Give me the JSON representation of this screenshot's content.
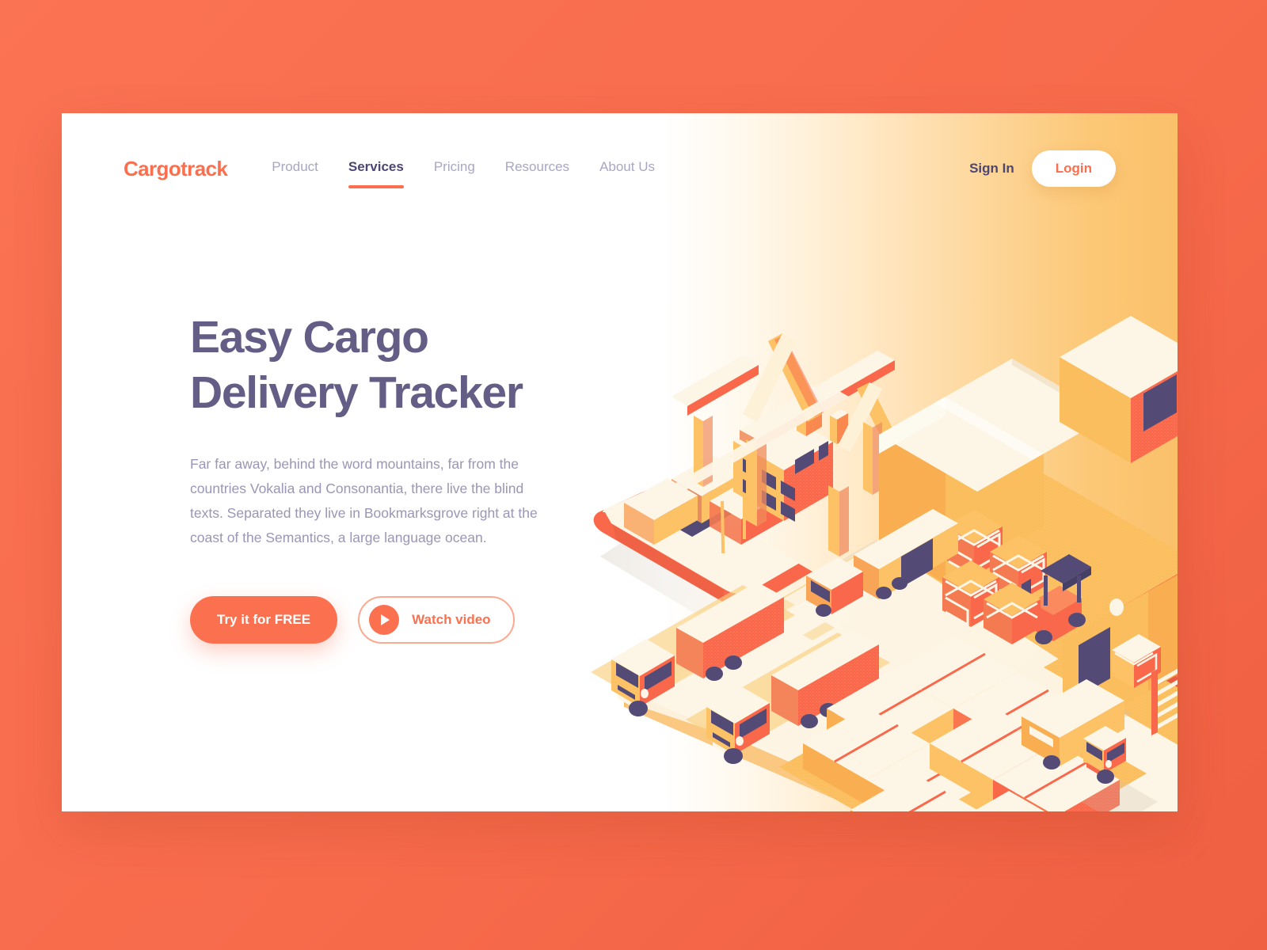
{
  "brand": {
    "name": "Cargotrack"
  },
  "nav": {
    "items": [
      {
        "label": "Product",
        "active": false
      },
      {
        "label": "Services",
        "active": true
      },
      {
        "label": "Pricing",
        "active": false
      },
      {
        "label": "Resources",
        "active": false
      },
      {
        "label": "About Us",
        "active": false
      }
    ],
    "sign_in_label": "Sign In",
    "login_label": "Login"
  },
  "hero": {
    "title_line1": "Easy Cargo",
    "title_line2": "Delivery Tracker",
    "subtitle": "Far far away, behind the word mountains, far from the countries Vokalia and Consonantia, there live the blind texts. Separated they live in Bookmarksgrove right at the coast of the Semantics, a large language ocean.",
    "primary_cta": "Try it for FREE",
    "secondary_cta": "Watch video"
  },
  "illustration": {
    "alt": "Isometric cargo port scene with container ship, gantry crane, warehouses, trucks, forklift and stacked shipping containers",
    "elements": [
      "container-ship",
      "gantry-crane",
      "warehouse-large",
      "warehouse-red-roof",
      "semi-truck",
      "semi-truck",
      "box-truck",
      "delivery-van",
      "forklift",
      "crate-stack",
      "container-stack",
      "dock-platform"
    ]
  },
  "colors": {
    "page_background": "#f96f4e",
    "card_background": "#ffffff",
    "gradient_end": "#fbc06a",
    "brand_orange": "#fb6f4e",
    "accent_orange": "#fb7150",
    "heading_purple": "#645d85",
    "body_purple": "#9a96b5",
    "nav_inactive": "#a9a6c4",
    "nav_active": "#4e4672",
    "illus_cream": "#fdf6e6",
    "illus_amber": "#fcc265",
    "illus_red": "#f9684a",
    "illus_deep_purple": "#534b76"
  }
}
